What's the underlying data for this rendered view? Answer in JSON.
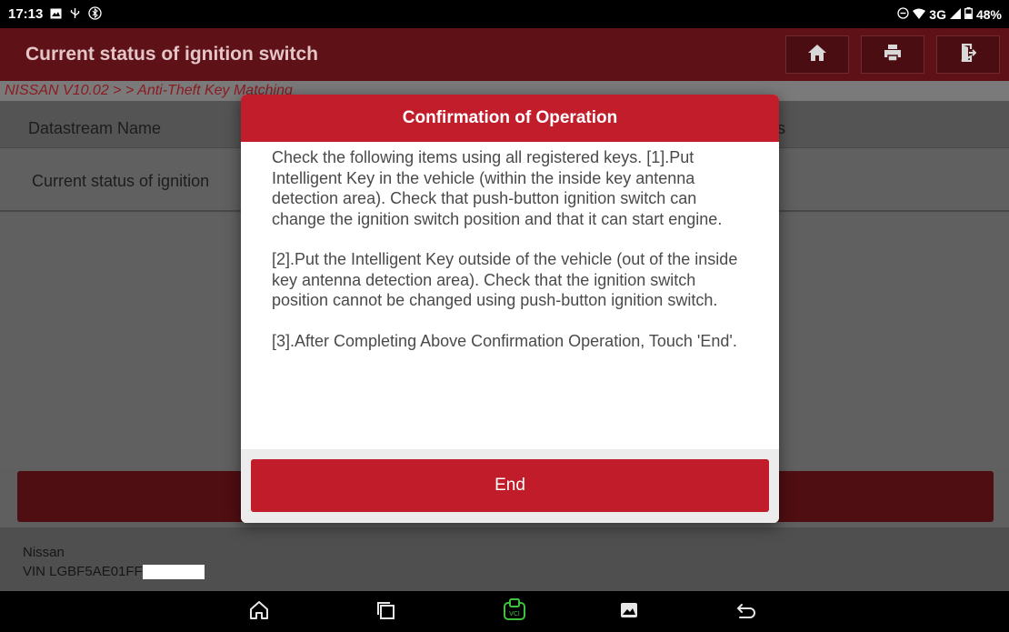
{
  "status_bar": {
    "time": "17:13",
    "network": "3G",
    "battery": "48%"
  },
  "header": {
    "title": "Current status of ignition switch",
    "buttons": [
      {
        "icon": "home-icon"
      },
      {
        "icon": "print-icon"
      },
      {
        "icon": "exit-icon"
      }
    ]
  },
  "breadcrumb": "NISSAN V10.02 >  > Anti-Theft Key Matching",
  "table": {
    "columns": [
      "Datastream Name",
      "s"
    ],
    "rows": [
      {
        "name": "Current status of ignition"
      }
    ]
  },
  "dialog": {
    "title": "Confirmation of Operation",
    "paragraphs": [
      "Check the following items using all registered keys. [1].Put Intelligent Key in the vehicle (within the inside key antenna detection area). Check that push-button ignition switch can change the ignition switch position and that it can start engine.",
      "[2].Put the Intelligent Key outside of the vehicle (out of the inside key antenna detection area). Check that the ignition switch position cannot be changed using push-button ignition switch.",
      "[3].After Completing Above Confirmation Operation, Touch 'End'."
    ],
    "button_label": "End"
  },
  "vehicle": {
    "make": "Nissan",
    "vin": "VIN LGBF5AE01FF"
  },
  "nav_bar": {
    "icons": [
      "home-icon",
      "recent-apps-icon",
      "vci-icon",
      "gallery-icon",
      "back-icon"
    ]
  },
  "colors": {
    "accent_red": "#c21d2b",
    "header_dim": "#5e1116",
    "vci_green": "#3ec23e"
  }
}
